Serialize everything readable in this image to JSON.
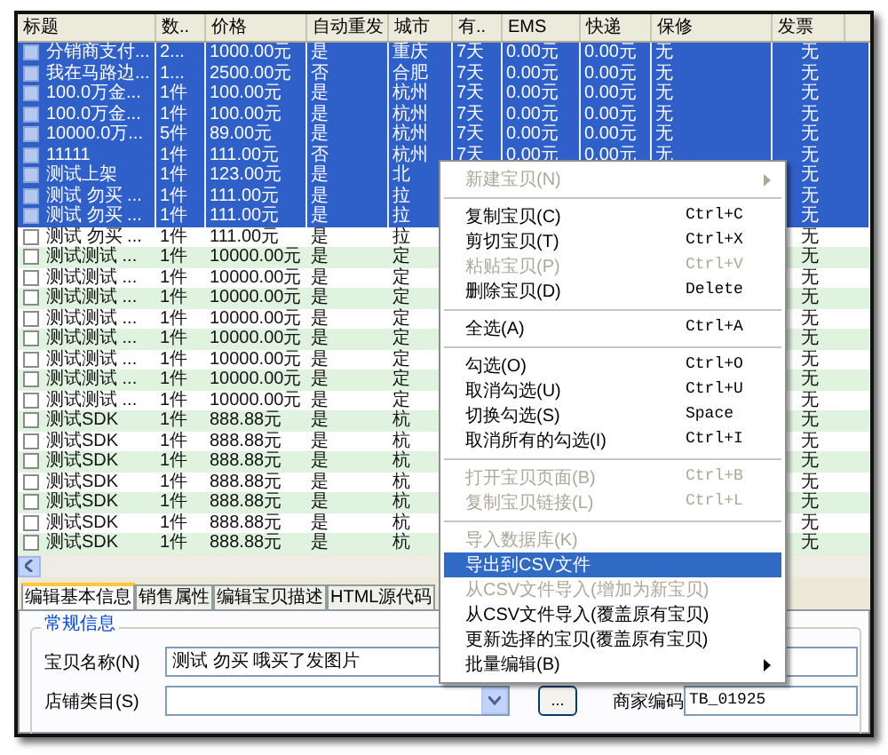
{
  "table": {
    "columns": [
      "标题",
      "数..",
      "价格",
      "自动重发",
      "城市",
      "有..",
      "EMS",
      "快递",
      "保修",
      "发票"
    ],
    "rows": [
      {
        "checked": false,
        "selected": true,
        "title": "分销商支付...",
        "quantity": "2...",
        "price": "1000.00元",
        "auto_relist": "是",
        "city": "重庆",
        "validity": "7天",
        "ems": "0.00元",
        "express": "0.00元",
        "warranty": "无",
        "invoice": "无"
      },
      {
        "checked": false,
        "selected": true,
        "title": "我在马路边...",
        "quantity": "1...",
        "price": "2500.00元",
        "auto_relist": "否",
        "city": "合肥",
        "validity": "7天",
        "ems": "0.00元",
        "express": "0.00元",
        "warranty": "无",
        "invoice": "无"
      },
      {
        "checked": false,
        "selected": true,
        "title": "100.0万金...",
        "quantity": "1件",
        "price": "100.00元",
        "auto_relist": "是",
        "city": "杭州",
        "validity": "7天",
        "ems": "0.00元",
        "express": "0.00元",
        "warranty": "无",
        "invoice": "无"
      },
      {
        "checked": false,
        "selected": true,
        "title": "100.0万金...",
        "quantity": "1件",
        "price": "100.00元",
        "auto_relist": "是",
        "city": "杭州",
        "validity": "7天",
        "ems": "0.00元",
        "express": "0.00元",
        "warranty": "无",
        "invoice": "无"
      },
      {
        "checked": false,
        "selected": true,
        "title": "10000.0万...",
        "quantity": "5件",
        "price": "89.00元",
        "auto_relist": "是",
        "city": "杭州",
        "validity": "7天",
        "ems": "0.00元",
        "express": "0.00元",
        "warranty": "无",
        "invoice": "无"
      },
      {
        "checked": false,
        "selected": true,
        "title": "11111",
        "quantity": "1件",
        "price": "111.00元",
        "auto_relist": "否",
        "city": "杭州",
        "validity": "7天",
        "ems": "0.00元",
        "express": "0.00元",
        "warranty": "无",
        "invoice": "无"
      },
      {
        "checked": false,
        "selected": true,
        "title": "测试上架",
        "quantity": "1件",
        "price": "123.00元",
        "auto_relist": "是",
        "city": "北",
        "invoice": "无"
      },
      {
        "checked": false,
        "selected": true,
        "title": "测试 勿买 ...",
        "quantity": "1件",
        "price": "111.00元",
        "auto_relist": "是",
        "city": "拉",
        "invoice": "无"
      },
      {
        "checked": false,
        "selected": true,
        "title": "测试 勿买 ...",
        "quantity": "1件",
        "price": "111.00元",
        "auto_relist": "是",
        "city": "拉",
        "invoice": "无"
      },
      {
        "checked": false,
        "selected": false,
        "title": "测试 勿买 ...",
        "quantity": "1件",
        "price": "111.00元",
        "auto_relist": "是",
        "city": "拉",
        "invoice": "无"
      },
      {
        "checked": false,
        "selected": false,
        "title": "测试测试 ...",
        "quantity": "1件",
        "price": "10000.00元",
        "auto_relist": "是",
        "city": "定",
        "invoice": "无"
      },
      {
        "checked": false,
        "selected": false,
        "title": "测试测试 ...",
        "quantity": "1件",
        "price": "10000.00元",
        "auto_relist": "是",
        "city": "定",
        "invoice": "无"
      },
      {
        "checked": false,
        "selected": false,
        "title": "测试测试 ...",
        "quantity": "1件",
        "price": "10000.00元",
        "auto_relist": "是",
        "city": "定",
        "invoice": "无"
      },
      {
        "checked": false,
        "selected": false,
        "title": "测试测试 ...",
        "quantity": "1件",
        "price": "10000.00元",
        "auto_relist": "是",
        "city": "定",
        "invoice": "无"
      },
      {
        "checked": false,
        "selected": false,
        "title": "测试测试 ...",
        "quantity": "1件",
        "price": "10000.00元",
        "auto_relist": "是",
        "city": "定",
        "invoice": "无"
      },
      {
        "checked": false,
        "selected": false,
        "title": "测试测试 ...",
        "quantity": "1件",
        "price": "10000.00元",
        "auto_relist": "是",
        "city": "定",
        "invoice": "无"
      },
      {
        "checked": false,
        "selected": false,
        "title": "测试测试 ...",
        "quantity": "1件",
        "price": "10000.00元",
        "auto_relist": "是",
        "city": "定",
        "invoice": "无"
      },
      {
        "checked": false,
        "selected": false,
        "title": "测试测试 ...",
        "quantity": "1件",
        "price": "10000.00元",
        "auto_relist": "是",
        "city": "定",
        "invoice": "无"
      },
      {
        "checked": false,
        "selected": false,
        "title": "测试SDK",
        "quantity": "1件",
        "price": "888.88元",
        "auto_relist": "是",
        "city": "杭",
        "invoice": "无"
      },
      {
        "checked": false,
        "selected": false,
        "title": "测试SDK",
        "quantity": "1件",
        "price": "888.88元",
        "auto_relist": "是",
        "city": "杭",
        "invoice": "无"
      },
      {
        "checked": false,
        "selected": false,
        "title": "测试SDK",
        "quantity": "1件",
        "price": "888.88元",
        "auto_relist": "是",
        "city": "杭",
        "invoice": "无"
      },
      {
        "checked": false,
        "selected": false,
        "title": "测试SDK",
        "quantity": "1件",
        "price": "888.88元",
        "auto_relist": "是",
        "city": "杭",
        "invoice": "无"
      },
      {
        "checked": false,
        "selected": false,
        "title": "测试SDK",
        "quantity": "1件",
        "price": "888.88元",
        "auto_relist": "是",
        "city": "杭",
        "invoice": "无"
      },
      {
        "checked": false,
        "selected": false,
        "title": "测试SDK",
        "quantity": "1件",
        "price": "888.88元",
        "auto_relist": "是",
        "city": "杭",
        "invoice": "无"
      },
      {
        "checked": false,
        "selected": false,
        "title": "测试SDK",
        "quantity": "1件",
        "price": "888.88元",
        "auto_relist": "是",
        "city": "杭",
        "invoice": "无"
      }
    ]
  },
  "tabs": [
    {
      "label": "编辑基本信息",
      "selected": true
    },
    {
      "label": "销售属性",
      "selected": false
    },
    {
      "label": "编辑宝贝描述",
      "selected": false
    },
    {
      "label": "HTML源代码",
      "selected": false
    }
  ],
  "form": {
    "group_title": "常规信息",
    "name_label": "宝贝名称(N)",
    "name_value": "测试 勿买 哦买了发图片",
    "category_label": "店铺类目(S)",
    "browse_button": "...",
    "code_label": "商家编码",
    "code_value": "TB_01925"
  },
  "context_menu": [
    {
      "kind": "item",
      "label": "新建宝贝(N)",
      "disabled": true,
      "selected": false,
      "submenu": true
    },
    {
      "kind": "separator"
    },
    {
      "kind": "item",
      "label": "复制宝贝(C)",
      "shortcut": "Ctrl+C",
      "disabled": false,
      "selected": false,
      "submenu": false
    },
    {
      "kind": "item",
      "label": "剪切宝贝(T)",
      "shortcut": "Ctrl+X",
      "disabled": false,
      "selected": false,
      "submenu": false
    },
    {
      "kind": "item",
      "label": "粘贴宝贝(P)",
      "shortcut": "Ctrl+V",
      "disabled": true,
      "selected": false,
      "submenu": false
    },
    {
      "kind": "item",
      "label": "删除宝贝(D)",
      "shortcut": "Delete",
      "disabled": false,
      "selected": false,
      "submenu": false
    },
    {
      "kind": "separator"
    },
    {
      "kind": "item",
      "label": "全选(A)",
      "shortcut": "Ctrl+A",
      "disabled": false,
      "selected": false,
      "submenu": false
    },
    {
      "kind": "separator"
    },
    {
      "kind": "item",
      "label": "勾选(O)",
      "shortcut": "Ctrl+O",
      "disabled": false,
      "selected": false,
      "submenu": false
    },
    {
      "kind": "item",
      "label": "取消勾选(U)",
      "shortcut": "Ctrl+U",
      "disabled": false,
      "selected": false,
      "submenu": false
    },
    {
      "kind": "item",
      "label": "切换勾选(S)",
      "shortcut": "Space",
      "disabled": false,
      "selected": false,
      "submenu": false
    },
    {
      "kind": "item",
      "label": "取消所有的勾选(I)",
      "shortcut": "Ctrl+I",
      "disabled": false,
      "selected": false,
      "submenu": false
    },
    {
      "kind": "separator"
    },
    {
      "kind": "item",
      "label": "打开宝贝页面(B)",
      "shortcut": "Ctrl+B",
      "disabled": true,
      "selected": false,
      "submenu": false
    },
    {
      "kind": "item",
      "label": "复制宝贝链接(L)",
      "shortcut": "Ctrl+L",
      "disabled": true,
      "selected": false,
      "submenu": false
    },
    {
      "kind": "separator"
    },
    {
      "kind": "item",
      "label": "导入数据库(K)",
      "disabled": true,
      "selected": false,
      "submenu": false
    },
    {
      "kind": "item",
      "label": "导出到CSV文件",
      "disabled": false,
      "selected": true,
      "submenu": false
    },
    {
      "kind": "item",
      "label": "从CSV文件导入(增加为新宝贝)",
      "disabled": true,
      "selected": false,
      "submenu": false
    },
    {
      "kind": "item",
      "label": "从CSV文件导入(覆盖原有宝贝)",
      "disabled": false,
      "selected": false,
      "submenu": false
    },
    {
      "kind": "item",
      "label": "更新选择的宝贝(覆盖原有宝贝)",
      "disabled": false,
      "selected": false,
      "submenu": false
    },
    {
      "kind": "item",
      "label": "批量编辑(B)",
      "disabled": false,
      "selected": false,
      "submenu": true
    }
  ]
}
